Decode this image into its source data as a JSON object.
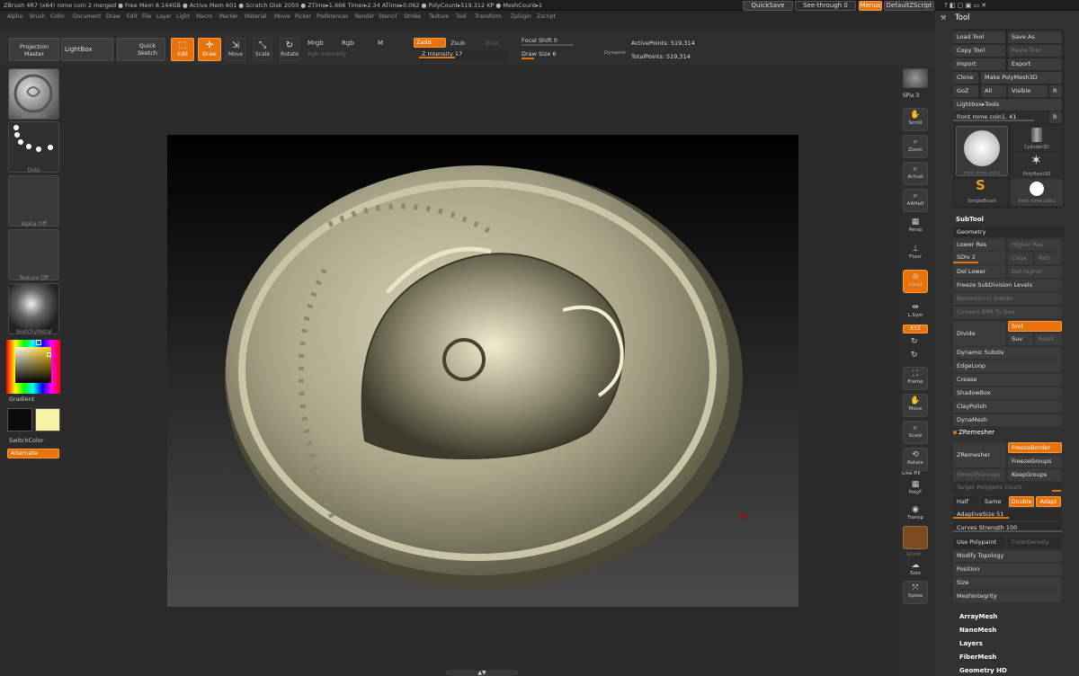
{
  "title_bar": {
    "text": "ZBrush 4R7 (x64)   rome coin 2 merged   ● Free Mem 8.144GB ● Active Mem 601 ● Scratch Disk 2050 ● ZTime▸1.666 Timer▸2.34 ATime▸0.062 ● PolyCount▸519.312 KP ● MeshCount▸1"
  },
  "top_right": {
    "quicksave": "QuickSave",
    "see_through": "See-through  0",
    "menus": "Menus",
    "default_script": "DefaultZScript"
  },
  "menu": [
    "Alpha",
    "Brush",
    "Color",
    "Document",
    "Draw",
    "Edit",
    "File",
    "Layer",
    "Light",
    "Macro",
    "Marker",
    "Material",
    "Movie",
    "Picker",
    "Preferences",
    "Render",
    "Stencil",
    "Stroke",
    "Texture",
    "Tool",
    "Transform",
    "Zplugin",
    "Zscript"
  ],
  "shelf": {
    "projection_master": "Projection Master",
    "lightbox": "LightBox",
    "quick_sketch": "Quick Sketch",
    "edit": "Edit",
    "draw": "Draw",
    "move": "Move",
    "scale": "Scale",
    "rotate": "Rotate",
    "mrgb": "Mrgb",
    "rgb": "Rgb",
    "m": "M",
    "rgb_intensity": "Rgb Intensity",
    "zadd": "Zadd",
    "zsub": "Zsub",
    "zcut": "Zcut",
    "z_intensity": "Z Intensity 17",
    "focal_shift": "Focal Shift 0",
    "draw_size": "Draw Size 6",
    "dynamic": "Dynamic",
    "active_points": "ActivePoints: 519,314",
    "total_points": "TotalPoints: 519,314"
  },
  "left": {
    "brush": "Standard",
    "stroke": "Dots",
    "alpha": "Alpha Off",
    "texture": "Texture Off",
    "material": "SketchyMetal",
    "gradient": "Gradient",
    "switch_color": "SwitchColor",
    "alternate": "Alternate",
    "main_color": "#0a0a0a",
    "secondary_color": "#f7f3a6"
  },
  "right_tools": [
    "SPix 3",
    "Scroll",
    "Zoom",
    "Actual",
    "AAHalf",
    "Persp",
    "Floor",
    "Local",
    "L.Sym",
    "XYZ",
    "Frame",
    "Move",
    "Scale",
    "Rotate",
    "Line Fill",
    "PolyF",
    "Transp",
    "Ghost",
    "Solo",
    "Xpose"
  ],
  "tool_panel": {
    "title": "Tool",
    "load_tool": "Load Tool",
    "save_as": "Save As",
    "copy_tool": "Copy Tool",
    "paste_tool": "Paste Tool",
    "import": "Import",
    "export": "Export",
    "clone": "Clone",
    "make_polymesh": "Make PolyMesh3D",
    "goz": "GoZ",
    "all": "All",
    "visible": "Visible",
    "r": "R",
    "lightbox_tools": "Lightbox▸Tools",
    "current_tool": "front rome coin1. 41",
    "thumbs": [
      "front rome coin1",
      "Cylinder3D",
      "PolyMesh3D",
      "SimpleBrush",
      "front rome coin1"
    ],
    "subtool": "SubTool",
    "geometry": "Geometry",
    "lower_res": "Lower Res",
    "higher_res": "Higher Res",
    "sdiv": "SDiv 2",
    "cage": "Cage",
    "rstr": "Rstr",
    "del_lower": "Del Lower",
    "del_higher": "Del Higher",
    "freeze_subdiv": "Freeze SubDivision Levels",
    "reconstruct": "Reconstruct Subdiv",
    "convert_bpr": "Convert BPR To Geo",
    "divide": "Divide",
    "smt": "Smt",
    "suv": "Suv",
    "reuv": "ReUV",
    "items": [
      "Dynamic Subdiv",
      "EdgeLoop",
      "Crease",
      "ShadowBox",
      "ClayPolish",
      "DynaMesh"
    ],
    "zremesher_hdr": "ZRemesher",
    "zremesher_btn": "ZRemesher",
    "freeze_border": "FreezeBorder",
    "freeze_groups": "FreezeGroups",
    "smooth_groups": "SmoothGroups",
    "keep_groups": "KeepGroups",
    "target_poly": "Target Polygons Count",
    "half": "Half",
    "same": "Same",
    "double": "Double",
    "adapt": "Adapt",
    "adaptive_size": "AdaptiveSize 51",
    "curves_strength": "Curves Strength 100",
    "use_polypaint": "Use Polypaint",
    "color_density": "ColorDensity",
    "more": [
      "Modify Topology",
      "Position",
      "Size",
      "MeshIntegrity"
    ],
    "sections": [
      "ArrayMesh",
      "NanoMesh",
      "Layers",
      "FiberMesh",
      "Geometry HD"
    ]
  }
}
